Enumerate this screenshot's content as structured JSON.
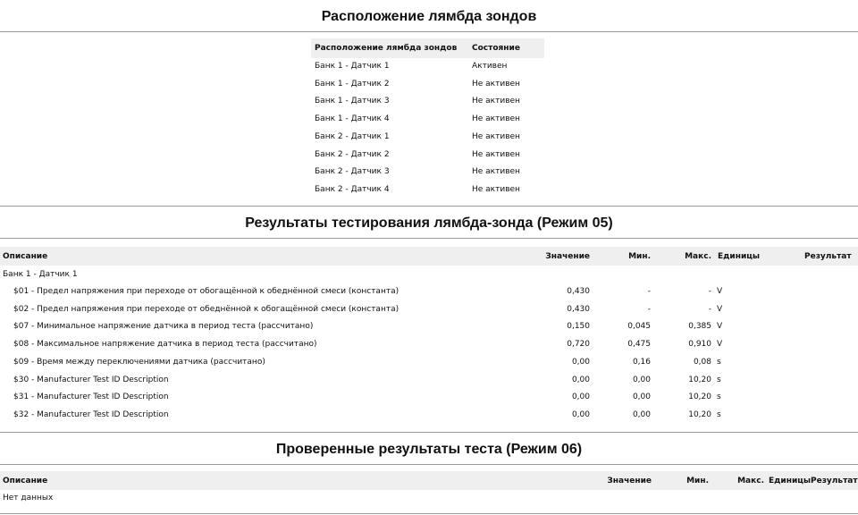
{
  "sensors_section": {
    "title": "Расположение лямбда зондов",
    "header": {
      "location": "Расположение лямбда зондов",
      "state": "Состояние"
    },
    "rows": [
      {
        "location": "Банк 1 - Датчик 1",
        "state": "Активен"
      },
      {
        "location": "Банк 1 - Датчик 2",
        "state": "Не активен"
      },
      {
        "location": "Банк 1 - Датчик 3",
        "state": "Не активен"
      },
      {
        "location": "Банк 1 - Датчик 4",
        "state": "Не активен"
      },
      {
        "location": "Банк 2 - Датчик 1",
        "state": "Не активен"
      },
      {
        "location": "Банк 2 - Датчик 2",
        "state": "Не активен"
      },
      {
        "location": "Банк 2 - Датчик 3",
        "state": "Не активен"
      },
      {
        "location": "Банк 2 - Датчик 4",
        "state": "Не активен"
      }
    ]
  },
  "mode05_section": {
    "title": "Результаты тестирования лямбда-зонда (Режим 05)",
    "header": {
      "description": "Описание",
      "value": "Значение",
      "min": "Мин.",
      "max": "Макс.",
      "units": "Единицы",
      "result": "Результат"
    },
    "group_label": "Банк 1 - Датчик 1",
    "rows": [
      {
        "description": "$01 - Предел напряжения при переходе от обогащённой к обеднённой смеси (константа)",
        "value": "0,430",
        "min": "-",
        "max": "-",
        "units": "V",
        "result": ""
      },
      {
        "description": "$02 - Предел напряжения при переходе от обеднённой к обогащённой смеси (константа)",
        "value": "0,430",
        "min": "-",
        "max": "-",
        "units": "V",
        "result": ""
      },
      {
        "description": "$07 - Минимальное напряжение датчика в период теста (рассчитано)",
        "value": "0,150",
        "min": "0,045",
        "max": "0,385",
        "units": "V",
        "result": ""
      },
      {
        "description": "$08 - Максимальное напряжение датчика в период теста (рассчитано)",
        "value": "0,720",
        "min": "0,475",
        "max": "0,910",
        "units": "V",
        "result": ""
      },
      {
        "description": "$09 - Время между переключениями датчика (рассчитано)",
        "value": "0,00",
        "min": "0,16",
        "max": "0,08",
        "units": "s",
        "result": ""
      },
      {
        "description": "$30 - Manufacturer Test ID Description",
        "value": "0,00",
        "min": "0,00",
        "max": "10,20",
        "units": "s",
        "result": ""
      },
      {
        "description": "$31 - Manufacturer Test ID Description",
        "value": "0,00",
        "min": "0,00",
        "max": "10,20",
        "units": "s",
        "result": ""
      },
      {
        "description": "$32 - Manufacturer Test ID Description",
        "value": "0,00",
        "min": "0,00",
        "max": "10,20",
        "units": "s",
        "result": ""
      }
    ]
  },
  "mode06_section": {
    "title": "Проверенные результаты теста (Режим 06)",
    "header": {
      "description": "Описание",
      "value": "Значение",
      "min": "Мин.",
      "max": "Макс.",
      "units": "Единицы",
      "result": "Результат"
    },
    "empty_text": "Нет данных"
  }
}
